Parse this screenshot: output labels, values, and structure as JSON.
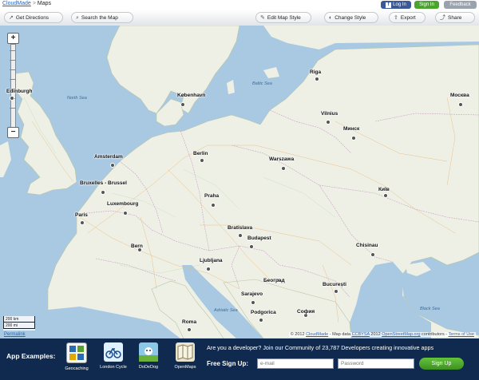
{
  "breadcrumb": {
    "brand": "CloudMade",
    "separator": ">",
    "page": "Maps"
  },
  "top_buttons": {
    "facebook": "Log In",
    "signin": "Sign In",
    "feedback": "Feedback"
  },
  "toolbar": {
    "get_directions": "Get Directions",
    "search_map": "Search the Map",
    "edit_style": "Edit Map Style",
    "change_style": "Change Style",
    "export": "Export",
    "share": "Share"
  },
  "map": {
    "cities": {
      "edinburgh": "Edinburgh",
      "kobenhavn": "København",
      "riga": "Riga",
      "moskva": "Москва",
      "vilnius": "Vilnius",
      "minsk": "Минск",
      "amsterdam": "Amsterdam",
      "berlin": "Berlin",
      "warszawa": "Warszawa",
      "bruxelles": "Bruxelles - Brussel",
      "luxembourg": "Luxembourg",
      "praha": "Praha",
      "kyiv": "Київ",
      "paris": "Paris",
      "bratislava": "Bratislava",
      "budapest": "Budapest",
      "chisinau": "Chisinau",
      "bern": "Bern",
      "ljubljana": "Ljubljana",
      "beograd": "Београд",
      "bucuresti": "București",
      "sarajevo": "Sarajevo",
      "podgorica": "Podgorica",
      "sofia": "София",
      "roma": "Roma"
    },
    "seas": {
      "north_sea": "North Sea",
      "baltic_sea": "Baltic Sea",
      "adriatic_sea": "Adriatic Sea",
      "black_sea": "Black Sea"
    },
    "scale": {
      "km": "200 km",
      "mi": "200 mi"
    },
    "permalink": "Permalink",
    "attribution": {
      "prefix": "© 2012",
      "cloudmade": "CloudMade",
      "mid": "- Map data",
      "ccbysa": "CCBYSA",
      "year": "2012",
      "osm": "OpenStreetMap.org",
      "contributors": "contributors -",
      "terms": "Terms of Use"
    }
  },
  "bottom": {
    "app_examples_label": "App Examples:",
    "apps": [
      "Geocaching",
      "London Cycle",
      "DoDeDog",
      "OpenMaps"
    ],
    "developer_text": "Are you a developer? Join our Community of 23,787 Developers creating innovative apps",
    "free_signup_label": "Free Sign Up:",
    "email_placeholder": "e-mail",
    "password_placeholder": "Password",
    "signup_button": "Sign Up"
  },
  "colors": {
    "water": "#a9c9e3",
    "land": "#eef0e6",
    "bottom_panel": "#0f2a4e",
    "accent_green": "#4aa52e",
    "facebook_blue": "#3b5998"
  }
}
